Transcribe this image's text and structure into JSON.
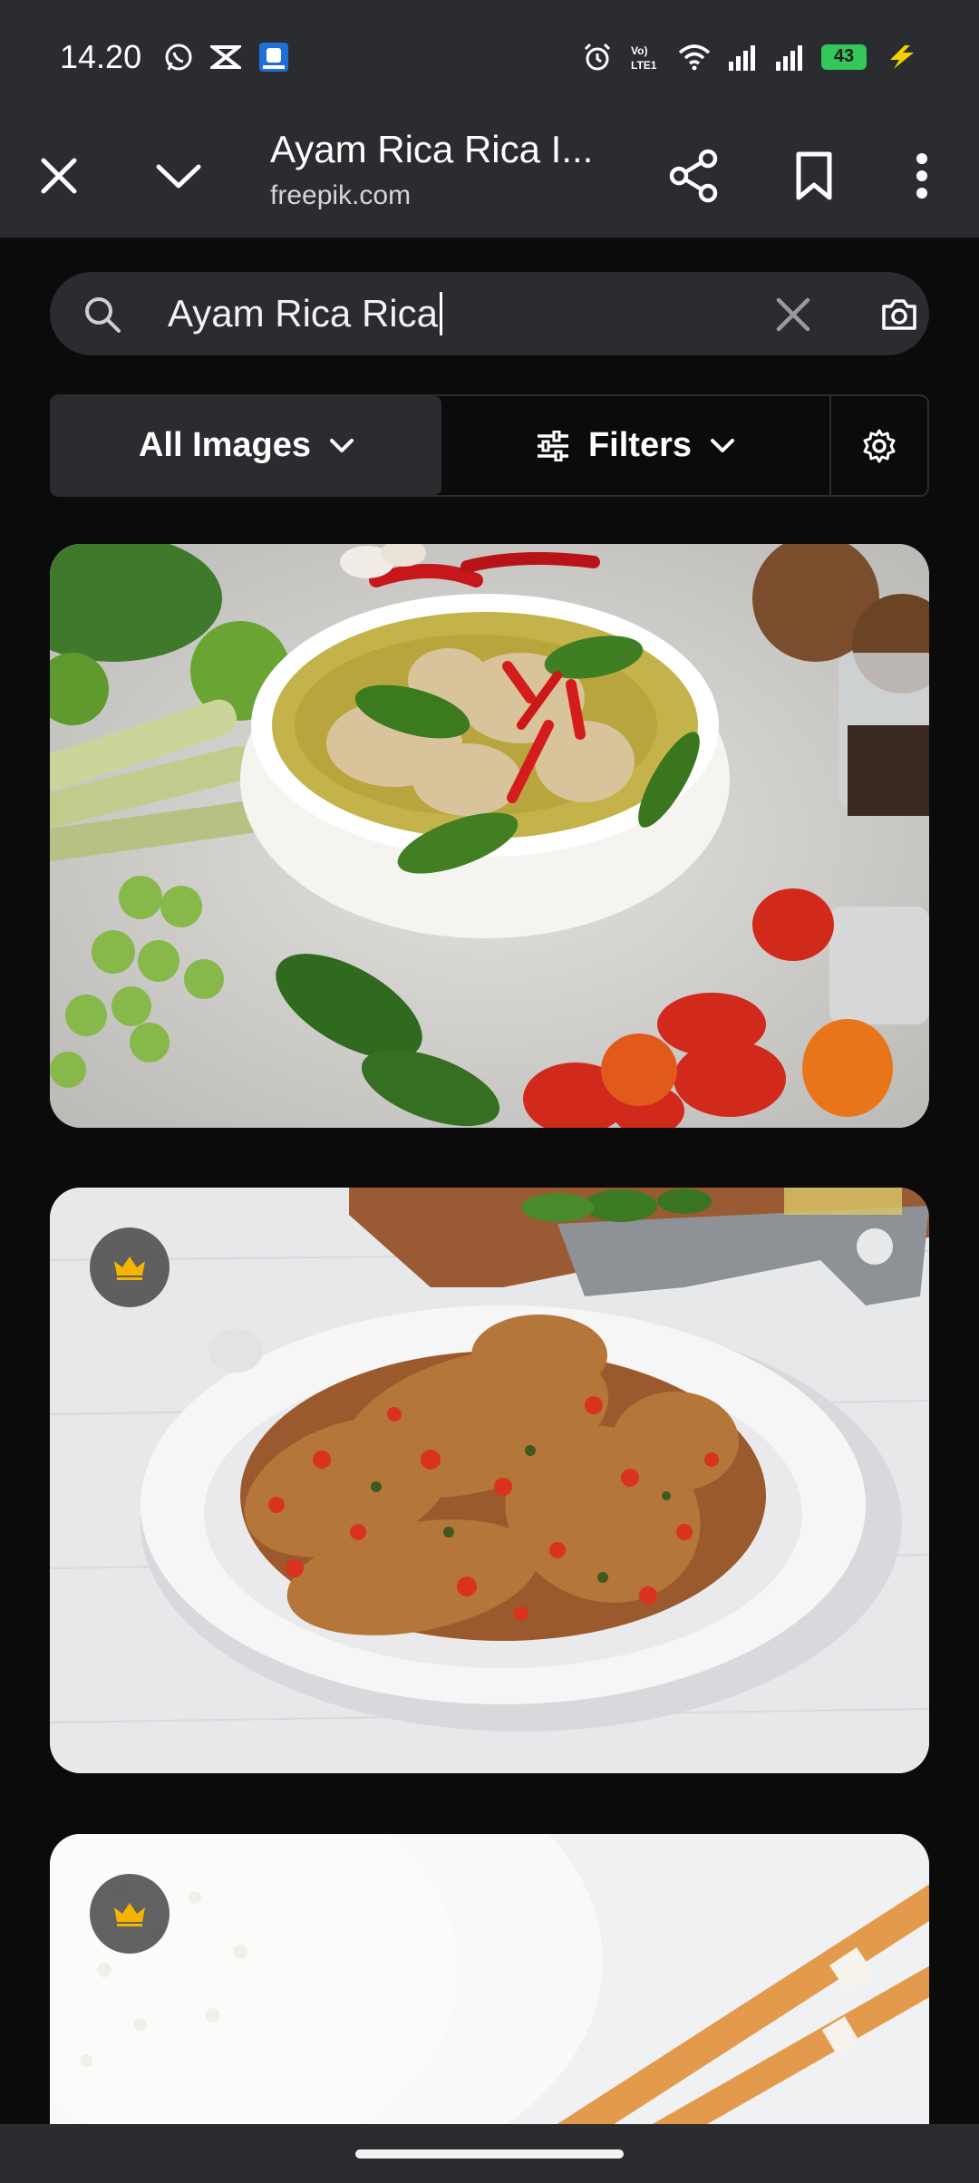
{
  "status": {
    "time": "14.20",
    "battery": "43"
  },
  "toolbar": {
    "title": "Ayam Rica Rica I...",
    "domain": "freepik.com"
  },
  "search": {
    "query": "Ayam Rica Rica"
  },
  "filters": {
    "all_images": "All Images",
    "filters": "Filters"
  },
  "icons": {
    "close": "close-icon",
    "collapse": "chevron-down-icon",
    "share": "share-icon",
    "bookmark": "bookmark-icon",
    "menu": "more-vert-icon",
    "search": "search-icon",
    "clear": "clear-icon",
    "camera": "camera-icon",
    "settings": "gear-icon",
    "premium": "crown-icon"
  },
  "colors": {
    "bar_bg": "#2b2c30",
    "page_bg": "#0b0b0c",
    "crown": "#f5b400"
  }
}
